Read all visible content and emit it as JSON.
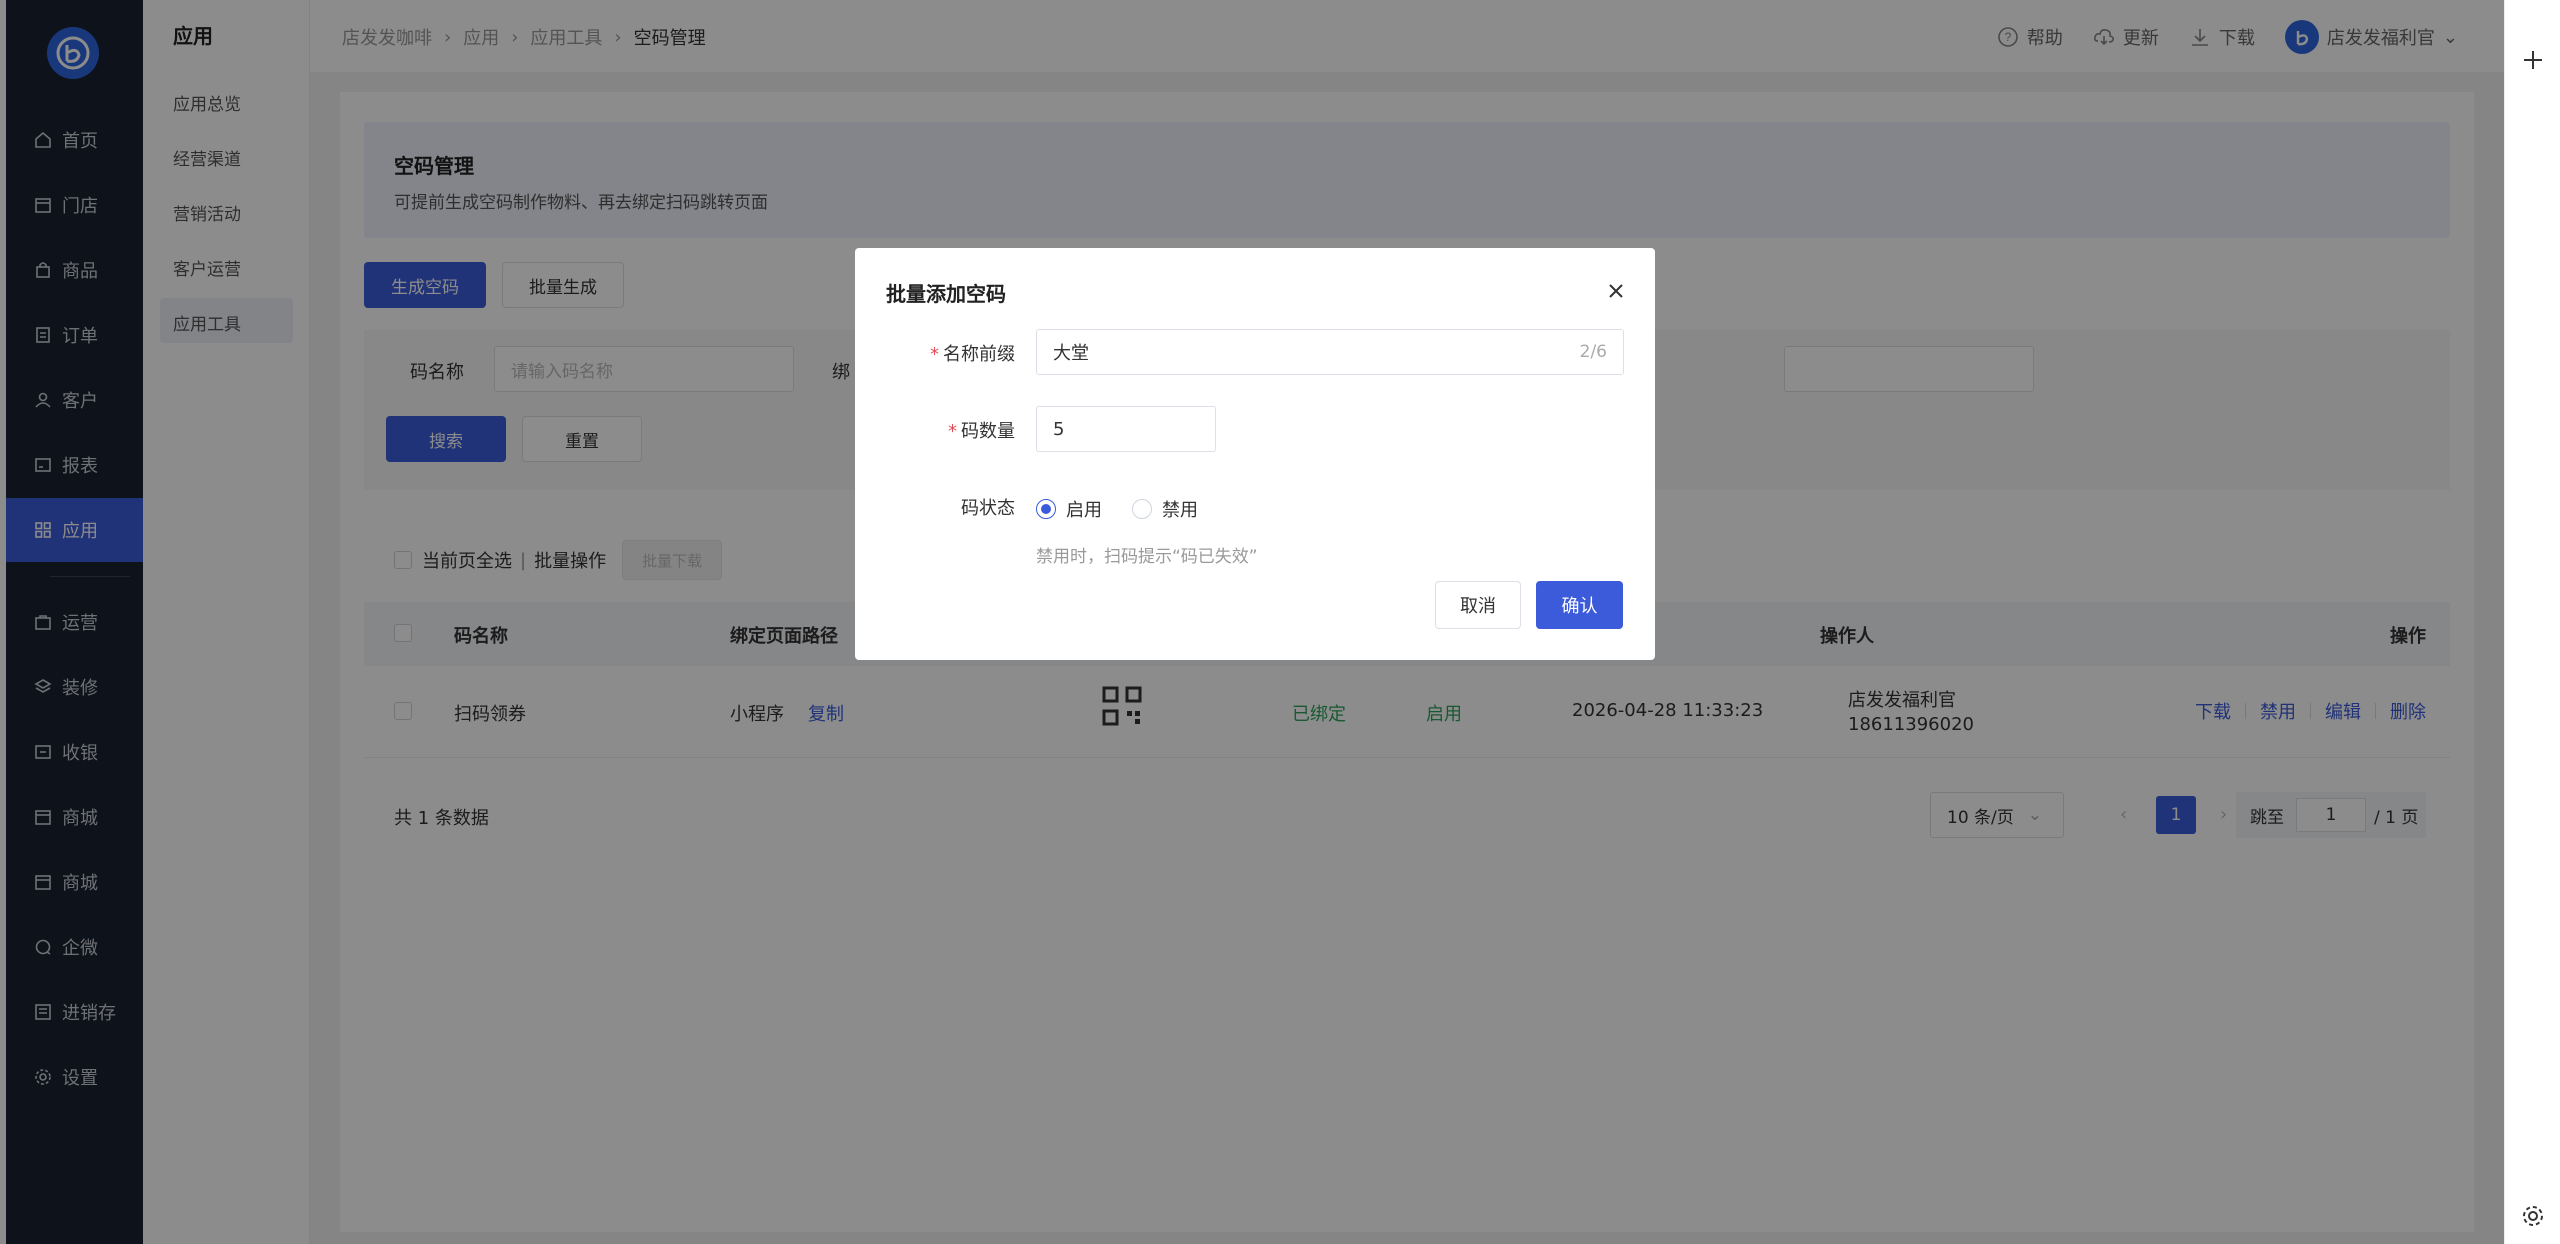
{
  "colors": {
    "primary": "#3b5bdb",
    "sidebar_bg": "#1b2230",
    "success": "#2fa35a",
    "required": "#e34d59"
  },
  "sidebar": {
    "items": [
      {
        "label": "首页",
        "icon": "home-icon"
      },
      {
        "label": "门店",
        "icon": "store-icon"
      },
      {
        "label": "商品",
        "icon": "bag-icon"
      },
      {
        "label": "订单",
        "icon": "order-icon"
      },
      {
        "label": "客户",
        "icon": "user-icon"
      },
      {
        "label": "报表",
        "icon": "report-icon"
      },
      {
        "label": "应用",
        "icon": "apps-icon"
      },
      {
        "label": "运营",
        "icon": "operation-icon"
      },
      {
        "label": "装修",
        "icon": "layers-icon"
      },
      {
        "label": "收银",
        "icon": "cashier-icon"
      },
      {
        "label": "商城",
        "icon": "mall-icon"
      },
      {
        "label": "商城",
        "icon": "mall-icon"
      },
      {
        "label": "企微",
        "icon": "chat-icon"
      },
      {
        "label": "进销存",
        "icon": "inventory-icon"
      },
      {
        "label": "设置",
        "icon": "settings-icon"
      }
    ]
  },
  "submenu": {
    "title": "应用",
    "items": [
      "应用总览",
      "经营渠道",
      "营销活动",
      "客户运营",
      "应用工具"
    ]
  },
  "breadcrumb": [
    "店发发咖啡",
    "应用",
    "应用工具",
    "空码管理"
  ],
  "topbar": {
    "help": "帮助",
    "update": "更新",
    "download": "下载",
    "user": "店发发福利官"
  },
  "page": {
    "title": "空码管理",
    "desc": "可提前生成空码制作物料、再去绑定扫码跳转页面",
    "btn_generate": "生成空码",
    "btn_batch": "批量生成",
    "filter_label": "码名称",
    "filter_placeholder": "请输入码名称",
    "filter_label2": "绑",
    "btn_search": "搜索",
    "btn_reset": "重置",
    "select_all": "当前页全选",
    "bulk_ops": "批量操作",
    "btn_bulk_download": "批量下载"
  },
  "table": {
    "headers": {
      "name": "码名称",
      "path": "绑定页面路径",
      "operator": "操作人",
      "ops": "操作"
    },
    "rows": [
      {
        "name": "扫码领券",
        "path": "小程序",
        "copy": "复制",
        "bind_status": "已绑定",
        "status": "启用",
        "time": "2026-04-28 11:33:23",
        "operator": "店发发福利官",
        "phone": "18611396020",
        "ops": [
          "下载",
          "禁用",
          "编辑",
          "删除"
        ]
      }
    ]
  },
  "footer": {
    "total": "共 1 条数据",
    "page_size": "10 条/页",
    "current_page": "1",
    "jump_label": "跳至",
    "jump_value": "1",
    "total_pages": "/ 1 页"
  },
  "modal": {
    "title": "批量添加空码",
    "prefix_label": "名称前缀",
    "prefix_value": "大堂",
    "prefix_counter": "2/6",
    "count_label": "码数量",
    "count_value": "5",
    "status_label": "码状态",
    "opt_enable": "启用",
    "opt_disable": "禁用",
    "hint": "禁用时，扫码提示“码已失效”",
    "cancel": "取消",
    "confirm": "确认"
  }
}
